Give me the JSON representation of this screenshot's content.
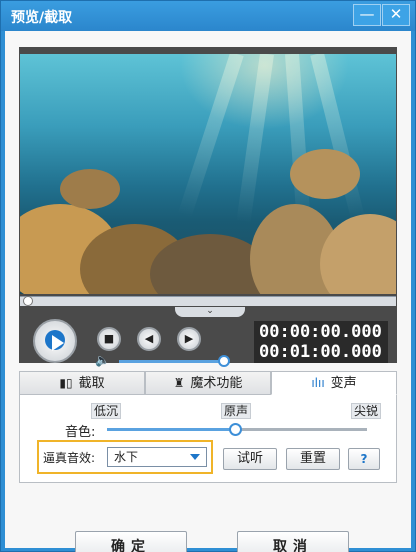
{
  "window": {
    "title": "预览/截取",
    "minimize_glyph": "—",
    "close_glyph": "✕"
  },
  "player": {
    "time_current": "00:00:00.000",
    "time_total": "00:01:00.000",
    "volume_fraction": 0.95,
    "seek_fraction": 0.0,
    "collapse_glyph": "⌄"
  },
  "tabs": [
    {
      "label": "截取",
      "icon": "film-cut-icon"
    },
    {
      "label": "魔术功能",
      "icon": "magic-hat-icon"
    },
    {
      "label": "变声",
      "icon": "soundwave-icon"
    }
  ],
  "voice": {
    "tone_low": "低沉",
    "tone_original": "原声",
    "tone_sharp": "尖锐",
    "tone_label": "音色:",
    "effect_label": "逼真音效:",
    "effect_value": "水下",
    "listen_label": "试听",
    "reset_label": "重置",
    "help_label": "?"
  },
  "footer": {
    "ok_label": "确定",
    "cancel_label": "取消"
  },
  "colors": {
    "titlebar": "#2f8fd4",
    "accent": "#1d76c9",
    "highlight_border": "#f0b429"
  }
}
